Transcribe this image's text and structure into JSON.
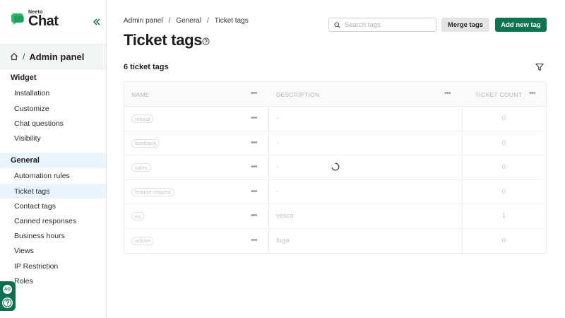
{
  "brand": {
    "small": "Neeto",
    "big": "Chat",
    "accent": "#0e7352"
  },
  "sidebar": {
    "admin_title": "Admin panel",
    "admin_sep": "/",
    "sections": [
      {
        "label": "Widget",
        "items": [
          "Installation",
          "Customize",
          "Chat questions",
          "Visibility"
        ]
      },
      {
        "label": "General",
        "items": [
          "Automation rules",
          "Ticket tags",
          "Contact tags",
          "Canned responses",
          "Business hours",
          "Views",
          "IP Restriction",
          "Roles"
        ]
      }
    ],
    "active_item": "Ticket tags",
    "avatar_initials": "AO"
  },
  "breadcrumb": [
    "Admin panel",
    "General",
    "Ticket tags"
  ],
  "breadcrumb_sep": "/",
  "page": {
    "title": "Ticket tags",
    "search_placeholder": "Search tags",
    "merge_label": "Merge tags",
    "add_label": "Add new tag",
    "count_label": "6 ticket tags"
  },
  "table": {
    "columns": [
      "NAME",
      "DESCRIPTION",
      "TICKET COUNT"
    ],
    "menu_glyph": "•••",
    "rows": [
      {
        "name": "refund",
        "description": "-",
        "count": "0"
      },
      {
        "name": "feedback",
        "description": "-",
        "count": "0"
      },
      {
        "name": "sales",
        "description": "-",
        "count": "0"
      },
      {
        "name": "feature-request",
        "description": "-",
        "count": "0"
      },
      {
        "name": "ea",
        "description": "vesco",
        "count": "1"
      },
      {
        "name": "adiuvo",
        "description": "fuga",
        "count": "0"
      }
    ]
  }
}
